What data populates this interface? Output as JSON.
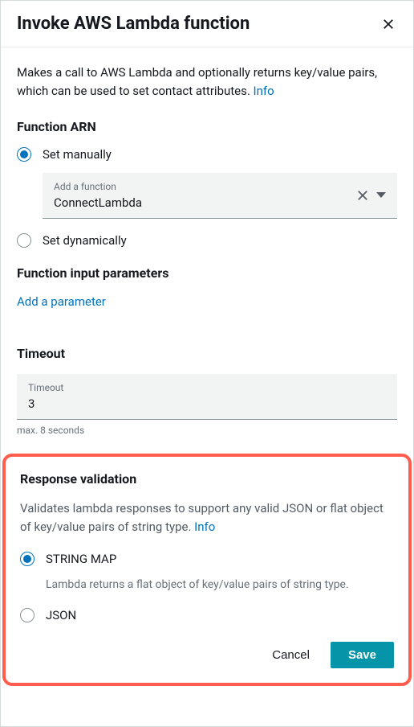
{
  "header": {
    "title": "Invoke AWS Lambda function"
  },
  "description": {
    "text_prefix": "Makes a call to AWS Lambda and optionally returns key/value pairs, which can be used to set contact attributes. ",
    "info_label": "Info"
  },
  "function_arn": {
    "title": "Function ARN",
    "set_manually_label": "Set manually",
    "set_dynamically_label": "Set dynamically",
    "dropdown": {
      "label": "Add a function",
      "value": "ConnectLambda"
    }
  },
  "input_params": {
    "title": "Function input parameters",
    "add_link": "Add a parameter"
  },
  "timeout": {
    "title": "Timeout",
    "input_label": "Timeout",
    "value": "3",
    "hint": "max. 8 seconds"
  },
  "response_validation": {
    "title": "Response validation",
    "desc_prefix": "Validates lambda responses to support any valid JSON or flat object of key/value pairs of string type. ",
    "info_label": "Info",
    "string_map_label": "STRING MAP",
    "string_map_desc": "Lambda returns a flat object of key/value pairs of string type.",
    "json_label": "JSON"
  },
  "footer": {
    "cancel_label": "Cancel",
    "save_label": "Save"
  }
}
